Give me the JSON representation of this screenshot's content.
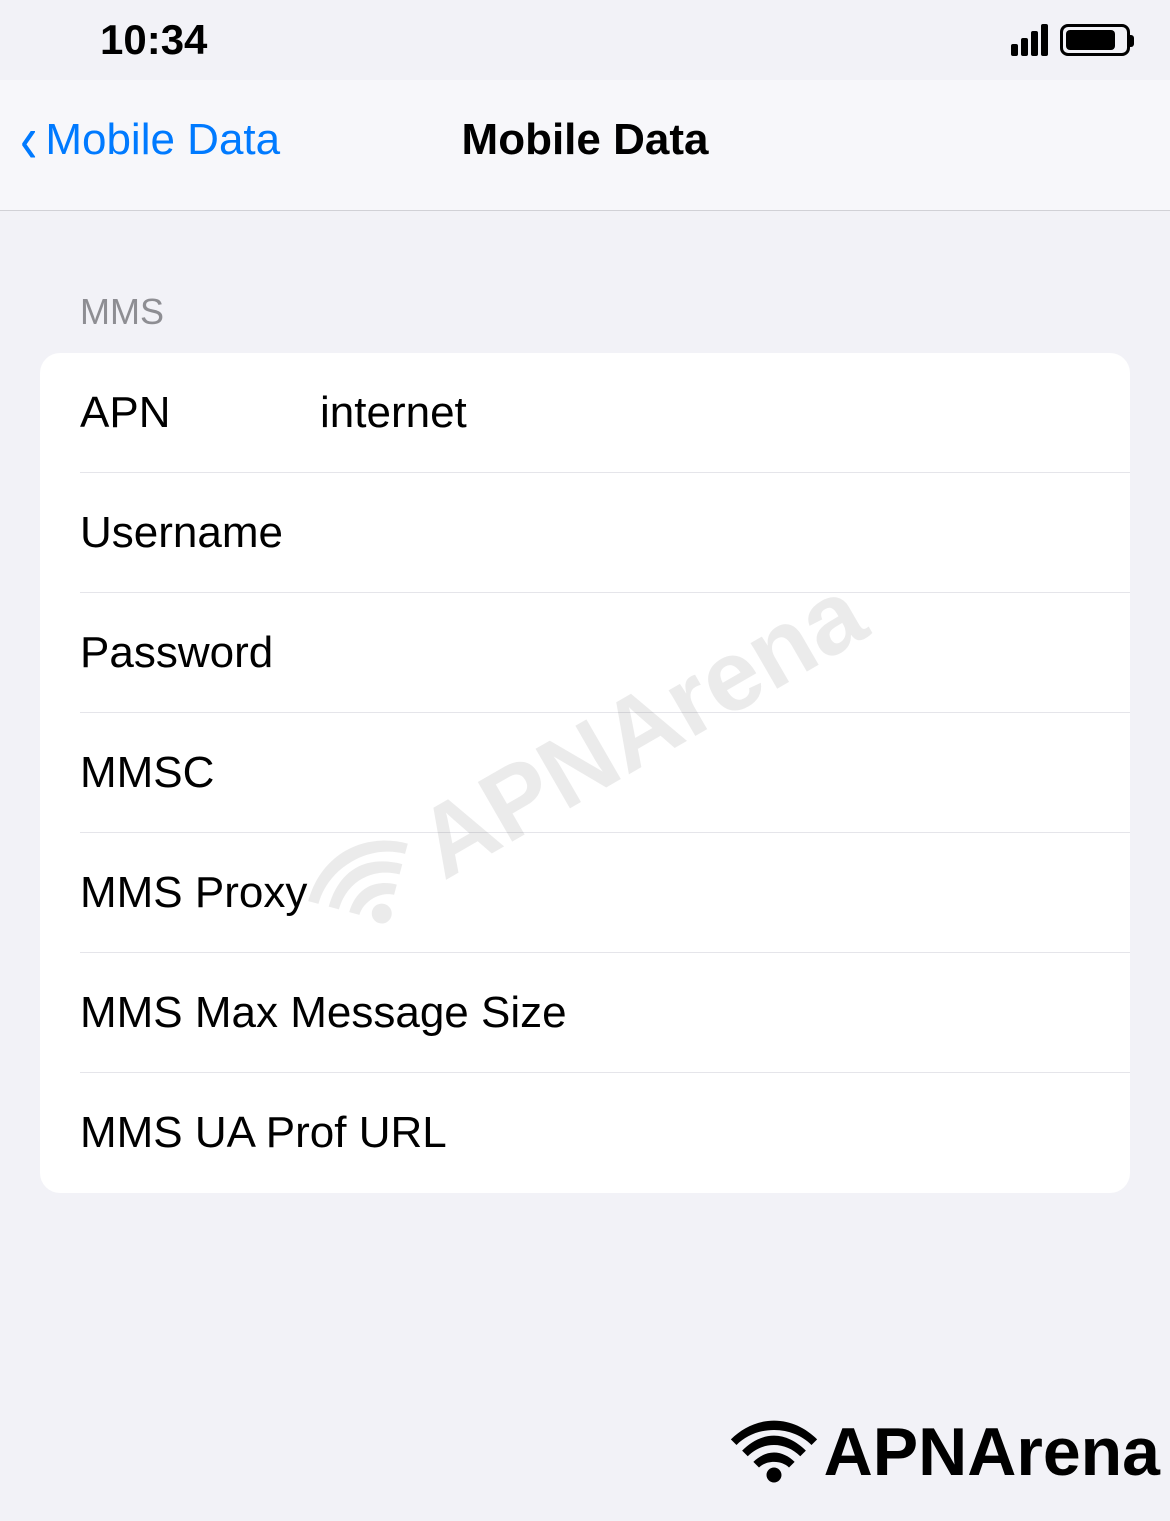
{
  "statusBar": {
    "time": "10:34"
  },
  "navBar": {
    "backLabel": "Mobile Data",
    "title": "Mobile Data"
  },
  "section": {
    "header": "MMS"
  },
  "fields": {
    "apn": {
      "label": "APN",
      "value": "internet"
    },
    "username": {
      "label": "Username",
      "value": ""
    },
    "password": {
      "label": "Password",
      "value": ""
    },
    "mmsc": {
      "label": "MMSC",
      "value": ""
    },
    "mmsProxy": {
      "label": "MMS Proxy",
      "value": ""
    },
    "mmsMaxSize": {
      "label": "MMS Max Message Size",
      "value": ""
    },
    "mmsUaProf": {
      "label": "MMS UA Prof URL",
      "value": ""
    }
  },
  "watermark": "APNArena",
  "footerLogo": "APNArena"
}
